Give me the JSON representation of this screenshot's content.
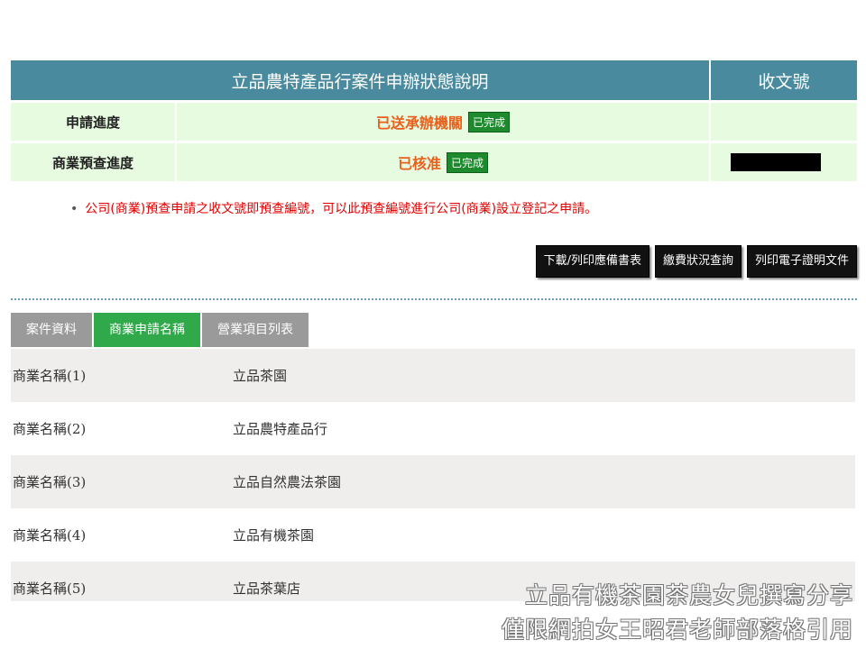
{
  "status_table": {
    "title": "立品農特產品行案件申辦狀態說明",
    "receipt_header": "收文號",
    "rows": [
      {
        "label": "申請進度",
        "status": "已送承辦機關",
        "badge": "已完成"
      },
      {
        "label": "商業預查進度",
        "status": "已核准",
        "badge": "已完成"
      }
    ]
  },
  "note": "公司(商業)預查申請之收文號即預查編號，可以此預查編號進行公司(商業)設立登記之申請。",
  "actions": {
    "download": "下載/列印應備書表",
    "payment": "繳費狀況查詢",
    "certificate": "列印電子證明文件"
  },
  "tabs": [
    "案件資料",
    "商業申請名稱",
    "營業項目列表"
  ],
  "names": [
    {
      "label": "商業名稱(1)",
      "value": "立品茶園"
    },
    {
      "label": "商業名稱(2)",
      "value": "立品農特產品行"
    },
    {
      "label": "商業名稱(3)",
      "value": "立品自然農法茶園"
    },
    {
      "label": "商業名稱(4)",
      "value": "立品有機茶園"
    },
    {
      "label": "商業名稱(5)",
      "value": "立品茶葉店"
    }
  ],
  "watermark": {
    "line1": "立品有機茶園茶農女兒撰寫分享",
    "line2": "僅限網拍女王昭君老師部落格引用"
  },
  "colors": {
    "header_bg": "#4a8a9e",
    "row_bg": "#e6fbe0",
    "status_orange": "#e8601c",
    "badge_green": "#1d8a2e",
    "note_red": "#e00000",
    "tab_active": "#2fa94a",
    "tab_inactive": "#9a9a9a"
  }
}
